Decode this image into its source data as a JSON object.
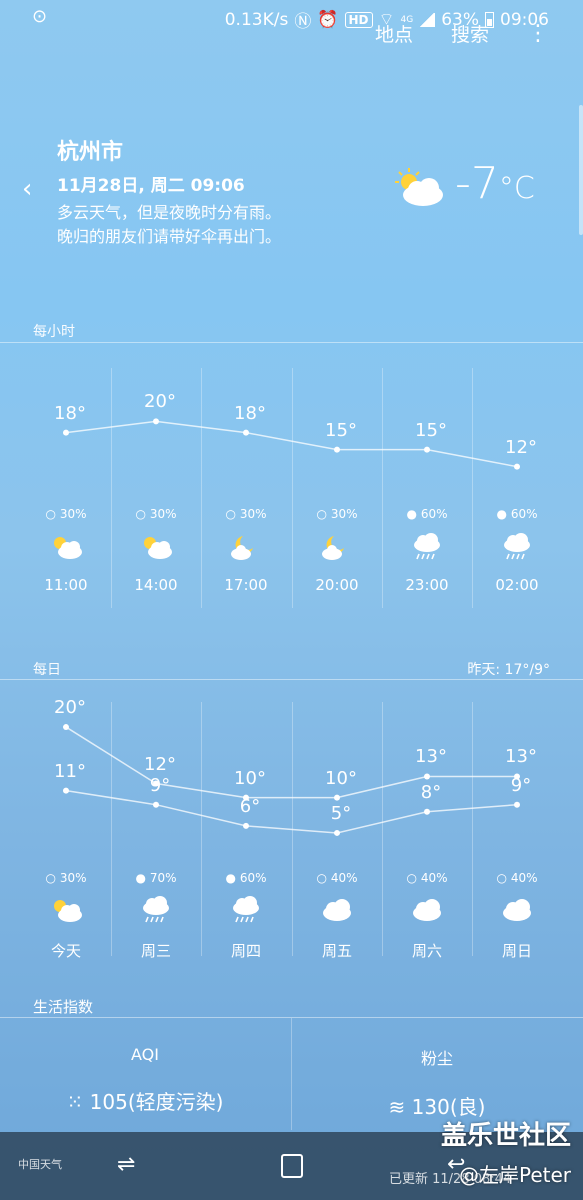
{
  "statusbar": {
    "speed": "0.13K/s",
    "hd": "HD",
    "net": "4G",
    "battery": "63%",
    "time": "09:06"
  },
  "topnav": {
    "location": "地点",
    "search": "搜索",
    "more": "⋮"
  },
  "current": {
    "city": "杭州市",
    "datetime": "11月28日, 周二 09:06",
    "desc1": "多云天气，但是夜晚时分有雨。",
    "desc2": "晚归的朋友们请带好伞再出门。",
    "temp": "-7",
    "unit": "°C",
    "icon": "partly-sunny-icon"
  },
  "hourly": {
    "label": "每小时",
    "items": [
      {
        "temp": "18°",
        "value": 18,
        "precip": "30%",
        "icon": "sun-cloud",
        "time": "11:00"
      },
      {
        "temp": "20°",
        "value": 20,
        "precip": "30%",
        "icon": "sun-cloud",
        "time": "14:00"
      },
      {
        "temp": "18°",
        "value": 18,
        "precip": "30%",
        "icon": "moon-cloud",
        "time": "17:00"
      },
      {
        "temp": "15°",
        "value": 15,
        "precip": "30%",
        "icon": "moon-cloud",
        "time": "20:00"
      },
      {
        "temp": "15°",
        "value": 15,
        "precip": "60%",
        "icon": "rain-cloud",
        "time": "23:00"
      },
      {
        "temp": "12°",
        "value": 12,
        "precip": "60%",
        "icon": "rain-cloud",
        "time": "02:00"
      }
    ]
  },
  "daily": {
    "label": "每日",
    "yesterday": "昨天: 17°/9°",
    "items": [
      {
        "high": "20°",
        "hv": 20,
        "low": "11°",
        "lv": 11,
        "precip": "30%",
        "icon": "sun-cloud",
        "day": "今天"
      },
      {
        "high": "12°",
        "hv": 12,
        "low": "9°",
        "lv": 9,
        "precip": "70%",
        "icon": "rain-cloud",
        "day": "周三"
      },
      {
        "high": "10°",
        "hv": 10,
        "low": "6°",
        "lv": 6,
        "precip": "60%",
        "icon": "rain-cloud",
        "day": "周四"
      },
      {
        "high": "10°",
        "hv": 10,
        "low": "5°",
        "lv": 5,
        "precip": "40%",
        "icon": "cloud",
        "day": "周五"
      },
      {
        "high": "13°",
        "hv": 13,
        "low": "8°",
        "lv": 8,
        "precip": "40%",
        "icon": "cloud",
        "day": "周六"
      },
      {
        "high": "13°",
        "hv": 13,
        "low": "9°",
        "lv": 9,
        "precip": "40%",
        "icon": "cloud",
        "day": "周日"
      }
    ]
  },
  "life": {
    "label": "生活指数",
    "aqi_title": "AQI",
    "aqi_value": "105(轻度污染)",
    "dust_title": "粉尘",
    "dust_value": "130(良)"
  },
  "footer": {
    "logo": "中国天气",
    "updated": "已更新 11/28 08:44"
  },
  "watermark": {
    "line1": "盖乐世社区",
    "line2": "@左岸Peter"
  }
}
